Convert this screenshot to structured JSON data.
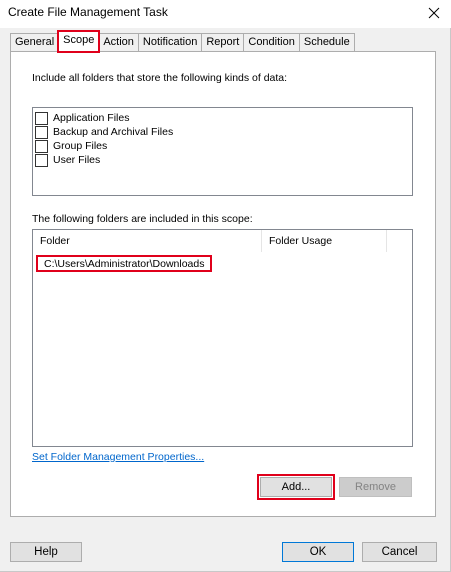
{
  "window": {
    "title": "Create File Management Task"
  },
  "tabs": [
    {
      "label": "General"
    },
    {
      "label": "Scope"
    },
    {
      "label": "Action"
    },
    {
      "label": "Notification"
    },
    {
      "label": "Report"
    },
    {
      "label": "Condition"
    },
    {
      "label": "Schedule"
    }
  ],
  "scope": {
    "kinds_label": "Include all folders that store the following kinds of data:",
    "kinds": [
      {
        "label": "Application Files",
        "checked": false
      },
      {
        "label": "Backup and Archival Files",
        "checked": false
      },
      {
        "label": "Group Files",
        "checked": false
      },
      {
        "label": "User Files",
        "checked": false
      }
    ],
    "folders_label": "The following folders are included in this scope:",
    "columns": [
      "Folder",
      "Folder Usage"
    ],
    "folders": [
      {
        "folder": "C:\\Users\\Administrator\\Downloads",
        "usage": ""
      }
    ],
    "link": "Set Folder Management Properties...",
    "add_label": "Add...",
    "remove_label": "Remove"
  },
  "footer": {
    "help_label": "Help",
    "ok_label": "OK",
    "cancel_label": "Cancel"
  },
  "colors": {
    "highlight": "#e0001b",
    "link": "#0066cc"
  },
  "icons": {
    "close": "close-icon"
  }
}
